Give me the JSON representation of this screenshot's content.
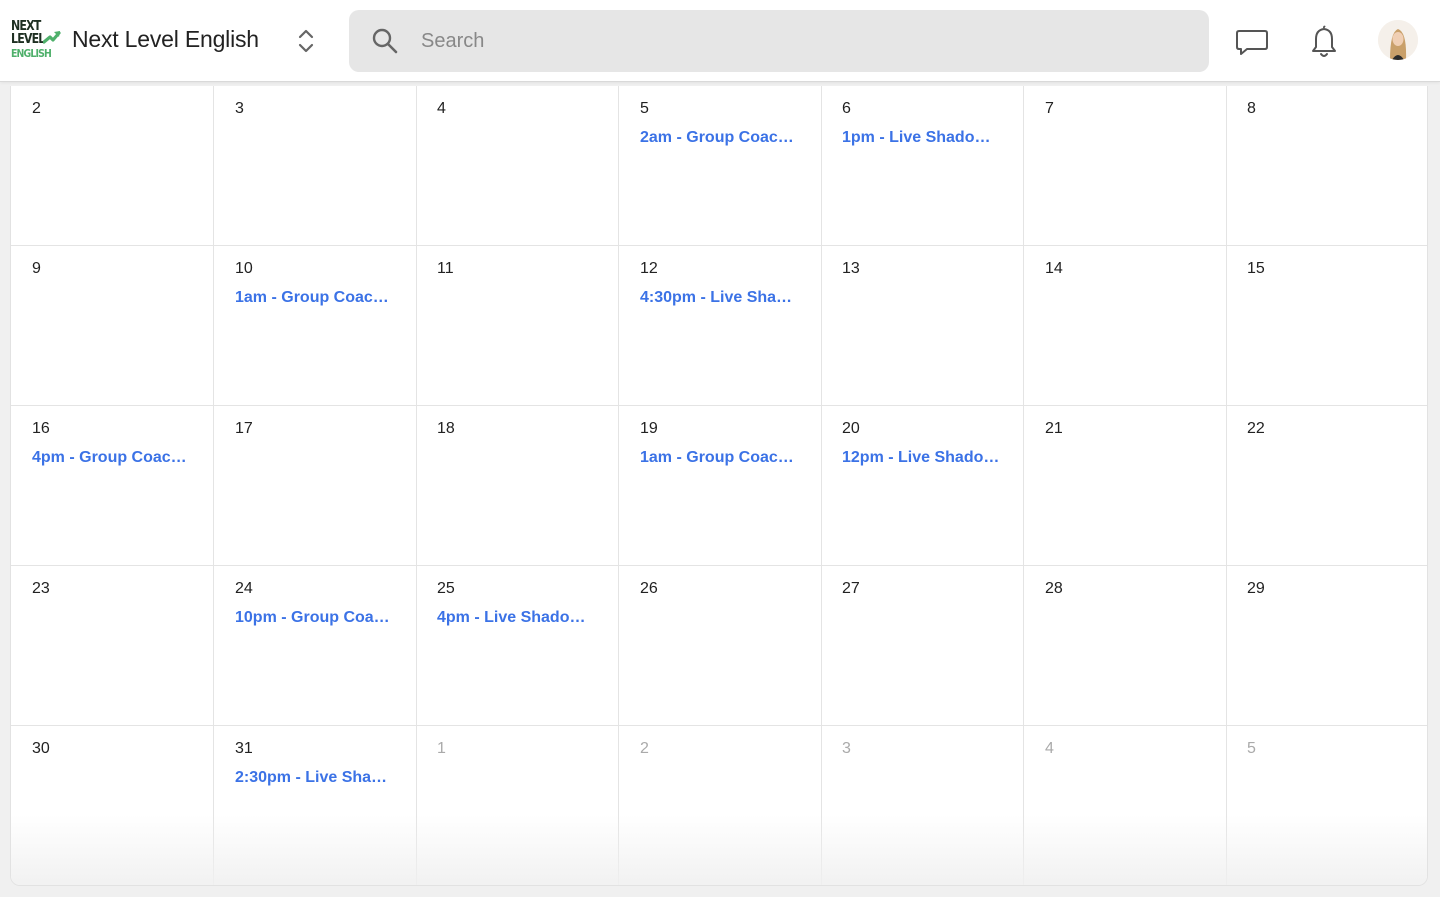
{
  "header": {
    "community_name": "Next Level English",
    "logo_lines": [
      "NEXT",
      "LEVEL",
      "ENGLISH"
    ],
    "search_placeholder": "Search",
    "icons": {
      "switcher": "chevron-up-down-icon",
      "search": "search-icon",
      "chat": "chat-bubble-icon",
      "notifications": "bell-icon",
      "avatar": "user-avatar"
    },
    "colors": {
      "logo_green": "#4fb06b",
      "logo_dark": "#1e2f22"
    }
  },
  "calendar": {
    "event_color": "#3b72e6",
    "weeks": [
      {
        "days": [
          {
            "day": "2",
            "event": ""
          },
          {
            "day": "3",
            "event": ""
          },
          {
            "day": "4",
            "event": ""
          },
          {
            "day": "5",
            "event": "2am - Group Coac…"
          },
          {
            "day": "6",
            "event": "1pm - Live Shadow…"
          },
          {
            "day": "7",
            "event": ""
          },
          {
            "day": "8",
            "event": ""
          }
        ]
      },
      {
        "days": [
          {
            "day": "9",
            "event": ""
          },
          {
            "day": "10",
            "event": "1am - Group Coac…"
          },
          {
            "day": "11",
            "event": ""
          },
          {
            "day": "12",
            "event": "4:30pm - Live Sha…"
          },
          {
            "day": "13",
            "event": ""
          },
          {
            "day": "14",
            "event": ""
          },
          {
            "day": "15",
            "event": ""
          }
        ]
      },
      {
        "days": [
          {
            "day": "16",
            "event": "4pm - Group Coac…"
          },
          {
            "day": "17",
            "event": ""
          },
          {
            "day": "18",
            "event": ""
          },
          {
            "day": "19",
            "event": "1am - Group Coac…"
          },
          {
            "day": "20",
            "event": "12pm - Live Shado…"
          },
          {
            "day": "21",
            "event": ""
          },
          {
            "day": "22",
            "event": ""
          }
        ]
      },
      {
        "days": [
          {
            "day": "23",
            "event": ""
          },
          {
            "day": "24",
            "event": "10pm - Group Coa…"
          },
          {
            "day": "25",
            "event": "4pm - Live Shadow…"
          },
          {
            "day": "26",
            "event": ""
          },
          {
            "day": "27",
            "event": ""
          },
          {
            "day": "28",
            "event": ""
          },
          {
            "day": "29",
            "event": ""
          }
        ]
      },
      {
        "days": [
          {
            "day": "30",
            "event": ""
          },
          {
            "day": "31",
            "event": "2:30pm - Live Sha…"
          },
          {
            "day": "1",
            "event": "",
            "other_month": true
          },
          {
            "day": "2",
            "event": "",
            "other_month": true
          },
          {
            "day": "3",
            "event": "",
            "other_month": true
          },
          {
            "day": "4",
            "event": "",
            "other_month": true
          },
          {
            "day": "5",
            "event": "",
            "other_month": true
          }
        ]
      }
    ]
  }
}
